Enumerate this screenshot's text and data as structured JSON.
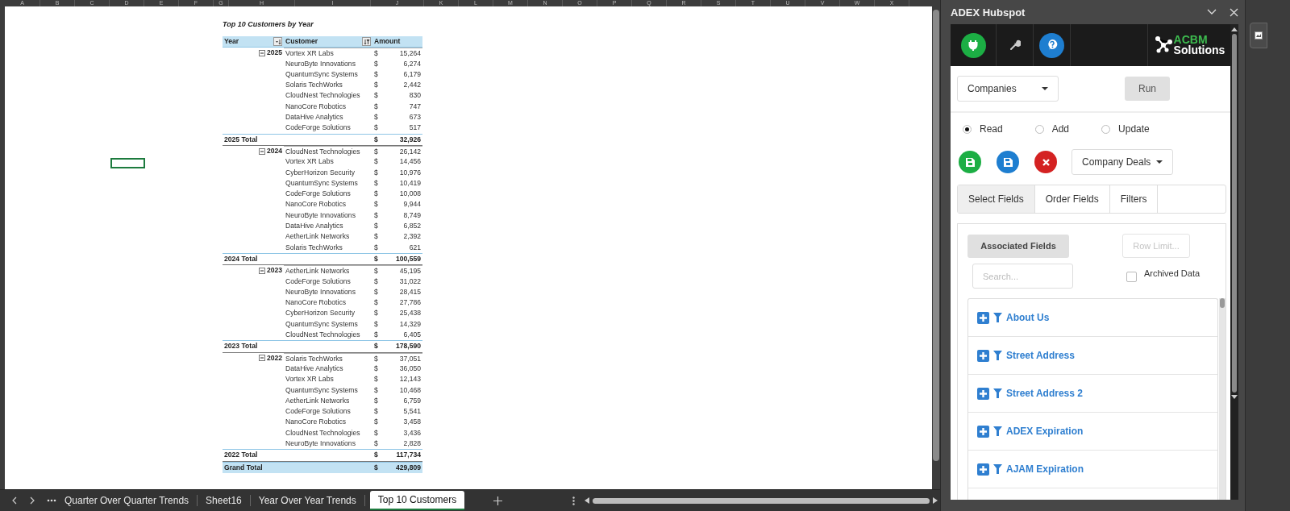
{
  "sheet": {
    "column_headers": [
      "A",
      "B",
      "C",
      "D",
      "E",
      "F",
      "G",
      "H",
      "I",
      "J",
      "K",
      "L",
      "M",
      "N",
      "O",
      "P",
      "Q",
      "R",
      "S",
      "T",
      "U",
      "V",
      "W",
      "X"
    ]
  },
  "pivot": {
    "title": "Top 10 Customers by Year",
    "headers": [
      {
        "label": "Year",
        "kind": "sort"
      },
      {
        "label": "Customer",
        "kind": "filter"
      },
      {
        "label": "Amount",
        "kind": "plain"
      }
    ],
    "groups": [
      {
        "year": "2025",
        "expanded": true,
        "total_label": "2025 Total",
        "total_currency": "$",
        "total": "32,926",
        "rows": [
          {
            "customer": "Vortex XR Labs",
            "currency": "$",
            "amount": "15,264"
          },
          {
            "customer": "NeuroByte Innovations",
            "currency": "$",
            "amount": "6,274"
          },
          {
            "customer": "QuantumSync Systems",
            "currency": "$",
            "amount": "6,179"
          },
          {
            "customer": "Solaris TechWorks",
            "currency": "$",
            "amount": "2,442"
          },
          {
            "customer": "CloudNest Technologies",
            "currency": "$",
            "amount": "830"
          },
          {
            "customer": "NanoCore Robotics",
            "currency": "$",
            "amount": "747"
          },
          {
            "customer": "DataHive Analytics",
            "currency": "$",
            "amount": "673"
          },
          {
            "customer": "CodeForge Solutions",
            "currency": "$",
            "amount": "517"
          }
        ]
      },
      {
        "year": "2024",
        "expanded": true,
        "total_label": "2024 Total",
        "total_currency": "$",
        "total": "100,559",
        "rows": [
          {
            "customer": "CloudNest Technologies",
            "currency": "$",
            "amount": "26,142"
          },
          {
            "customer": "Vortex XR Labs",
            "currency": "$",
            "amount": "14,456"
          },
          {
            "customer": "CyberHorizon Security",
            "currency": "$",
            "amount": "10,976"
          },
          {
            "customer": "QuantumSync Systems",
            "currency": "$",
            "amount": "10,419"
          },
          {
            "customer": "CodeForge Solutions",
            "currency": "$",
            "amount": "10,008"
          },
          {
            "customer": "NanoCore Robotics",
            "currency": "$",
            "amount": "9,944"
          },
          {
            "customer": "NeuroByte Innovations",
            "currency": "$",
            "amount": "8,749"
          },
          {
            "customer": "DataHive Analytics",
            "currency": "$",
            "amount": "6,852"
          },
          {
            "customer": "AetherLink Networks",
            "currency": "$",
            "amount": "2,392"
          },
          {
            "customer": "Solaris TechWorks",
            "currency": "$",
            "amount": "621"
          }
        ]
      },
      {
        "year": "2023",
        "expanded": true,
        "total_label": "2023 Total",
        "total_currency": "$",
        "total": "178,590",
        "rows": [
          {
            "customer": "AetherLink Networks",
            "currency": "$",
            "amount": "45,195"
          },
          {
            "customer": "CodeForge Solutions",
            "currency": "$",
            "amount": "31,022"
          },
          {
            "customer": "NeuroByte Innovations",
            "currency": "$",
            "amount": "28,415"
          },
          {
            "customer": "NanoCore Robotics",
            "currency": "$",
            "amount": "27,786"
          },
          {
            "customer": "CyberHorizon Security",
            "currency": "$",
            "amount": "25,438"
          },
          {
            "customer": "QuantumSync Systems",
            "currency": "$",
            "amount": "14,329"
          },
          {
            "customer": "CloudNest Technologies",
            "currency": "$",
            "amount": "6,405"
          }
        ]
      },
      {
        "year": "2022",
        "expanded": true,
        "total_label": "2022 Total",
        "total_currency": "$",
        "total": "117,734",
        "rows": [
          {
            "customer": "Solaris TechWorks",
            "currency": "$",
            "amount": "37,051"
          },
          {
            "customer": "DataHive Analytics",
            "currency": "$",
            "amount": "36,050"
          },
          {
            "customer": "Vortex XR Labs",
            "currency": "$",
            "amount": "12,143"
          },
          {
            "customer": "QuantumSync Systems",
            "currency": "$",
            "amount": "10,468"
          },
          {
            "customer": "AetherLink Networks",
            "currency": "$",
            "amount": "6,759"
          },
          {
            "customer": "CodeForge Solutions",
            "currency": "$",
            "amount": "5,541"
          },
          {
            "customer": "NanoCore Robotics",
            "currency": "$",
            "amount": "3,458"
          },
          {
            "customer": "CloudNest Technologies",
            "currency": "$",
            "amount": "3,436"
          },
          {
            "customer": "NeuroByte Innovations",
            "currency": "$",
            "amount": "2,828"
          }
        ]
      }
    ],
    "grand_total": {
      "label": "Grand Total",
      "currency": "$",
      "amount": "429,809"
    }
  },
  "sheet_tabs": [
    {
      "label": "Quarter Over Quarter Trends",
      "selected": false
    },
    {
      "label": "Sheet16",
      "selected": false
    },
    {
      "label": "Year Over Year Trends",
      "selected": false
    },
    {
      "label": "Top 10 Customers",
      "selected": true
    }
  ],
  "task_pane": {
    "title": "ADEX Hubspot",
    "logo": {
      "line1": "ACBM",
      "line2": "Solutions"
    },
    "object_dropdown": "Companies",
    "run_button": "Run",
    "modes": [
      {
        "label": "Read",
        "selected": true
      },
      {
        "label": "Add",
        "selected": false
      },
      {
        "label": "Update",
        "selected": false
      }
    ],
    "deals_dropdown": "Company Deals",
    "tabs": [
      {
        "label": "Select Fields",
        "selected": true
      },
      {
        "label": "Order Fields",
        "selected": false
      },
      {
        "label": "Filters",
        "selected": false
      }
    ],
    "associated_button": "Associated Fields",
    "row_limit": {
      "label": "Row Limit...",
      "disabled": true
    },
    "search_placeholder": "Search...",
    "archived": {
      "label": "Archived Data",
      "checked": false
    },
    "fields": [
      "About Us",
      "Street Address",
      "Street Address 2",
      "ADEX Expiration",
      "AJAM Expiration"
    ]
  }
}
